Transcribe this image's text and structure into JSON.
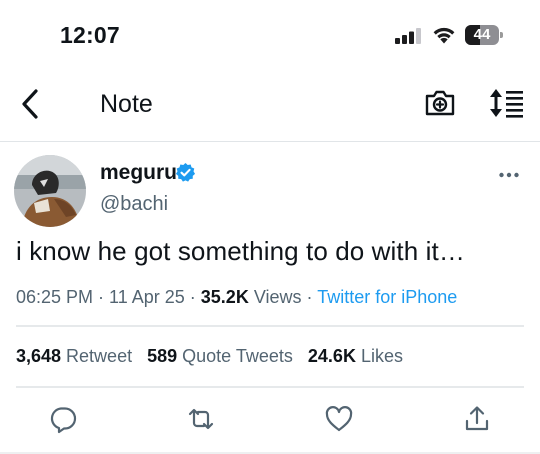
{
  "status_bar": {
    "time": "12:07",
    "battery_level": "44",
    "icons": [
      "cellular-signal-icon",
      "wifi-icon",
      "battery-icon"
    ]
  },
  "nav": {
    "title": "Note",
    "back_icon": "chevron-left-icon",
    "camera_icon": "camera-icon",
    "sort_icon": "sort-icon"
  },
  "tweet": {
    "display_name": "meguru",
    "username": "@bachi",
    "verified": true,
    "more_icon": "more-horizontal-icon",
    "text": "i know he got something to do with it…",
    "time": "06:25 PM",
    "sep1": " · ",
    "date": "11 Apr 25",
    "sep2": " · ",
    "views_count": "35.2K",
    "views_label": " Views",
    "sep3": " · ",
    "source": "Twitter for iPhone",
    "retweets_count": "3,648",
    "retweets_label": " Retweet",
    "quotes_count": "589",
    "quotes_label": " Quote Tweets",
    "likes_count": "24.6K",
    "likes_label": " Likes"
  },
  "actions": [
    {
      "icon": "reply-icon"
    },
    {
      "icon": "retweet-icon"
    },
    {
      "icon": "like-icon"
    },
    {
      "icon": "share-icon"
    }
  ],
  "colors": {
    "accent": "#1d9bf0",
    "text": "#0f1419",
    "secondary": "#536471",
    "divider": "#e6e9eb"
  }
}
